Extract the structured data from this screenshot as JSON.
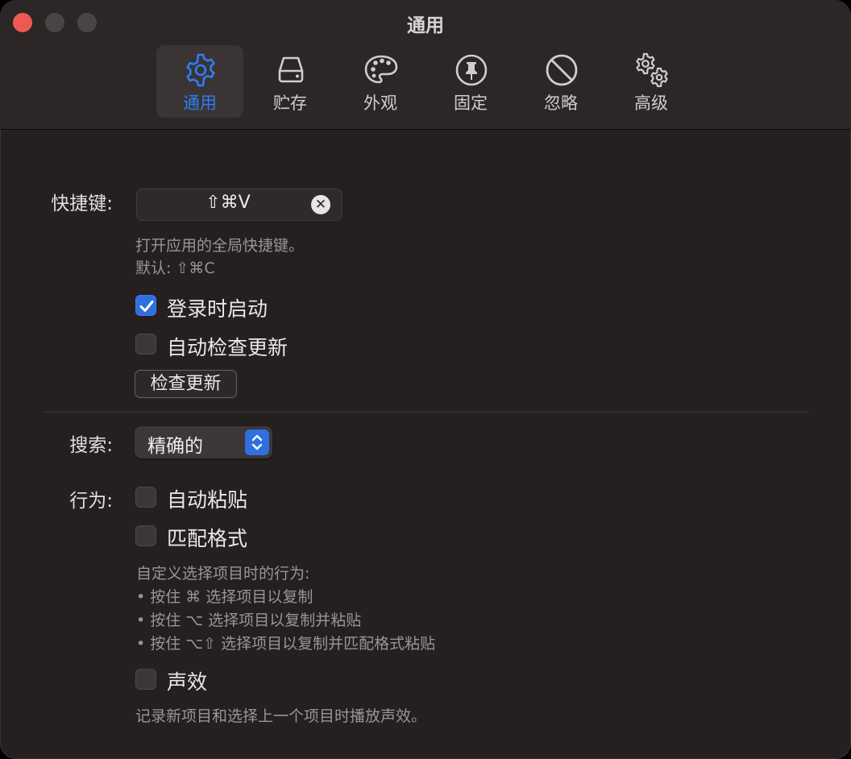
{
  "window": {
    "title": "通用"
  },
  "toolbar": {
    "tabs": [
      {
        "label": "通用",
        "icon": "gear-icon",
        "active": true
      },
      {
        "label": "贮存",
        "icon": "storage-drive-icon",
        "active": false
      },
      {
        "label": "外观",
        "icon": "palette-icon",
        "active": false
      },
      {
        "label": "固定",
        "icon": "pin-icon",
        "active": false
      },
      {
        "label": "忽略",
        "icon": "prohibited-icon",
        "active": false
      },
      {
        "label": "高级",
        "icon": "gears-advanced-icon",
        "active": false
      }
    ]
  },
  "general": {
    "shortcut_label": "快捷键:",
    "shortcut_value": "⇧⌘V",
    "shortcut_hint_line1": "打开应用的全局快捷键。",
    "shortcut_hint_line2": "默认: ⇧⌘C",
    "launch_at_login": {
      "label": "登录时启动",
      "checked": true
    },
    "auto_check_updates": {
      "label": "自动检查更新",
      "checked": false
    },
    "check_updates_button": "检查更新",
    "search_label": "搜索:",
    "search_mode": "精确的",
    "behavior_label": "行为:",
    "auto_paste": {
      "label": "自动粘贴",
      "checked": false
    },
    "match_format": {
      "label": "匹配格式",
      "checked": false
    },
    "behavior_tip": [
      "自定义选择项目时的行为:",
      "• 按住 ⌘ 选择项目以复制",
      "• 按住 ⌥ 选择项目以复制并粘贴",
      "• 按住 ⌥⇧ 选择项目以复制并匹配格式粘贴"
    ],
    "sound_effects": {
      "label": "声效",
      "checked": false
    },
    "sound_hint": "记录新项目和选择上一个项目时播放声效。"
  },
  "colors": {
    "accent": "#2f7cf6",
    "close_button": "#ee5a52",
    "window_bg": "#251f1f"
  }
}
